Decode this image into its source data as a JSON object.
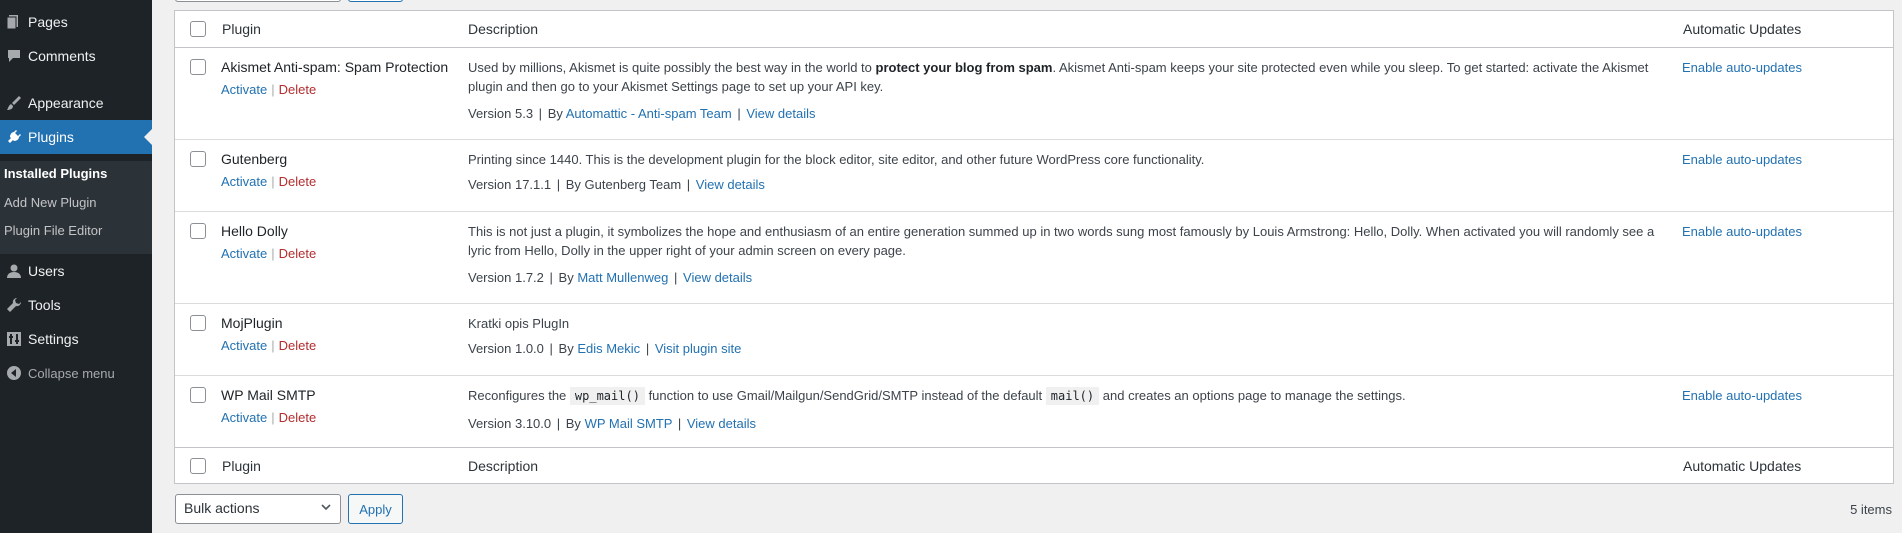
{
  "sidebar": {
    "items": [
      {
        "label": "Pages",
        "icon": "pages-icon"
      },
      {
        "label": "Comments",
        "icon": "comments-icon"
      },
      {
        "label": "Appearance",
        "icon": "appearance-icon"
      },
      {
        "label": "Plugins",
        "icon": "plugins-icon"
      },
      {
        "label": "Users",
        "icon": "users-icon"
      },
      {
        "label": "Tools",
        "icon": "tools-icon"
      },
      {
        "label": "Settings",
        "icon": "settings-icon"
      },
      {
        "label": "Collapse menu",
        "icon": "collapse-icon"
      }
    ],
    "submenu": [
      "Installed Plugins",
      "Add New Plugin",
      "Plugin File Editor"
    ]
  },
  "table": {
    "headers": {
      "plugin": "Plugin",
      "description": "Description",
      "auto": "Automatic Updates"
    },
    "actions": {
      "activate": "Activate",
      "delete": "Delete",
      "separator": "|"
    },
    "rows": [
      {
        "name": "Akismet Anti-spam: Spam Protection",
        "desc_pre": "Used by millions, Akismet is quite possibly the best way in the world to ",
        "desc_bold": "protect your blog from spam",
        "desc_post": ". Akismet Anti-spam keeps your site protected even while you sleep. To get started: activate the Akismet plugin and then go to your Akismet Settings page to set up your API key.",
        "version": "Version 5.3",
        "by": "By",
        "author": "Automattic - Anti-spam Team",
        "details": "View details",
        "auto": "Enable auto-updates"
      },
      {
        "name": "Gutenberg",
        "desc": "Printing since 1440. This is the development plugin for the block editor, site editor, and other future WordPress core functionality.",
        "version": "Version 17.1.1",
        "by_text": "By Gutenberg Team",
        "details": "View details",
        "auto": "Enable auto-updates"
      },
      {
        "name": "Hello Dolly",
        "desc": "This is not just a plugin, it symbolizes the hope and enthusiasm of an entire generation summed up in two words sung most famously by Louis Armstrong: Hello, Dolly. When activated you will randomly see a lyric from Hello, Dolly in the upper right of your admin screen on every page.",
        "version": "Version 1.7.2",
        "by": "By",
        "author": "Matt Mullenweg",
        "details": "View details",
        "auto": "Enable auto-updates"
      },
      {
        "name": "MojPlugin",
        "desc": "Kratki opis PlugIn",
        "version": "Version 1.0.0",
        "by": "By",
        "author": "Edis Mekic",
        "details": "Visit plugin site"
      },
      {
        "name": "WP Mail SMTP",
        "desc_a": "Reconfigures the",
        "code1": "wp_mail()",
        "desc_b": "function to use Gmail/Mailgun/SendGrid/SMTP instead of the default",
        "code2": "mail()",
        "desc_c": "and creates an options page to manage the settings.",
        "version": "Version 3.10.0",
        "by": "By",
        "author": "WP Mail SMTP",
        "details": "View details",
        "auto": "Enable auto-updates"
      }
    ]
  },
  "footer": {
    "bulk_actions": "Bulk actions",
    "apply": "Apply",
    "count": "5 items"
  },
  "colors": {
    "sidebar_bg": "#1d2327",
    "accent": "#2271b1",
    "delete": "#b32d2e"
  }
}
